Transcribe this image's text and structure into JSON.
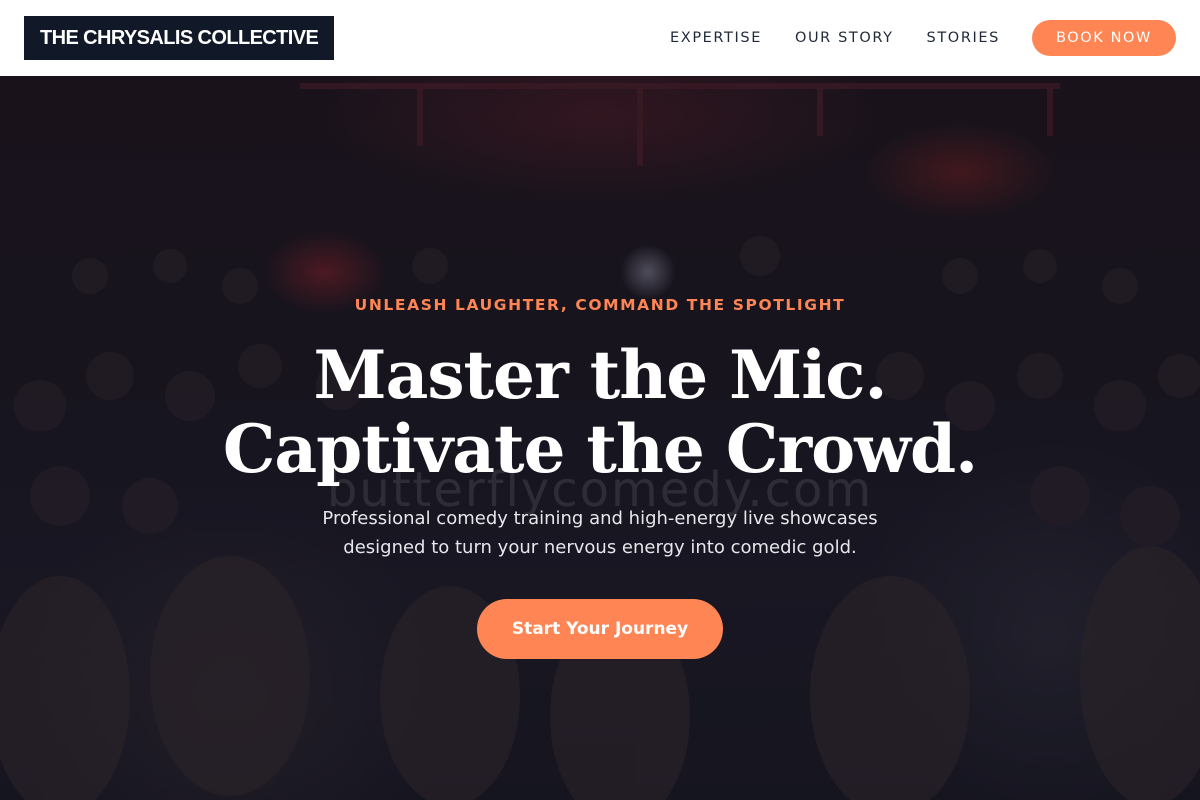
{
  "header": {
    "logo": "THE CHRYSALIS COLLECTIVE",
    "nav": [
      "EXPERTISE",
      "OUR STORY",
      "STORIES"
    ],
    "cta_label": "BOOK NOW"
  },
  "hero": {
    "eyebrow": "UNLEASH LAUGHTER, COMMAND THE SPOTLIGHT",
    "headline_line1": "Master the Mic.",
    "headline_line2": "Captivate the Crowd.",
    "subtitle_line1": "Professional comedy training and high-energy live showcases",
    "subtitle_line2": "designed to turn your nervous energy into comedic gold.",
    "cta_label": "Start Your Journey",
    "watermark": "butterflycomedy.com"
  },
  "colors": {
    "accent": "#ff8654",
    "logo_bg": "#111827",
    "header_bg": "#ffffff"
  }
}
